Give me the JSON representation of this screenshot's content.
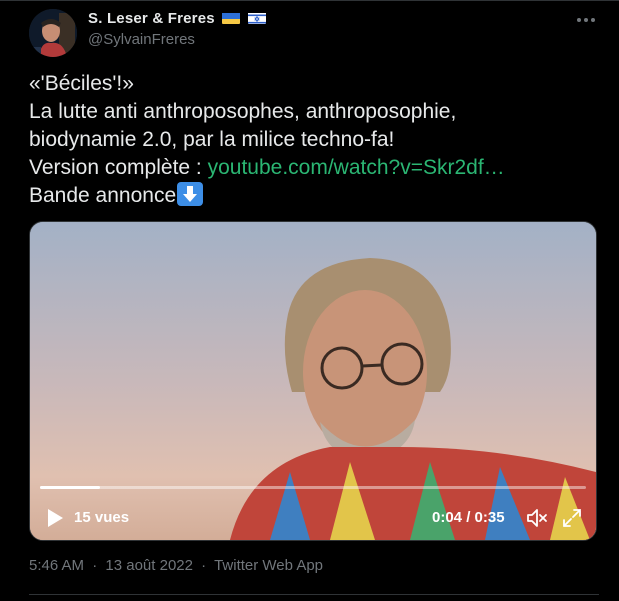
{
  "author": {
    "display_name": "S. Leser & Freres",
    "handle": "@SylvainFreres",
    "flags": [
      "ukraine-flag",
      "israel-flag"
    ]
  },
  "tweet": {
    "line1": "«'Béciles'!»",
    "line2": "La lutte anti anthroposophes, anthroposophie,",
    "line3": "biodynamie 2.0, par la milice techno-fa!",
    "line4_prefix": "Version complète : ",
    "link_text": "youtube.com/watch?v=Skr2df…",
    "line5": "Bande annonce",
    "emoji": "down-arrow-emoji"
  },
  "video": {
    "views": "15 vues",
    "time": "0:04 / 0:35",
    "progress": 0.11
  },
  "meta": {
    "time": "5:46 AM",
    "date": "13 août 2022",
    "source": "Twitter Web App",
    "separator": "·"
  },
  "colors": {
    "background": "#000000",
    "text": "#e7e9ea",
    "muted": "#71767b",
    "link": "#2bb673",
    "emoji_bg": "#3d8ee6"
  }
}
